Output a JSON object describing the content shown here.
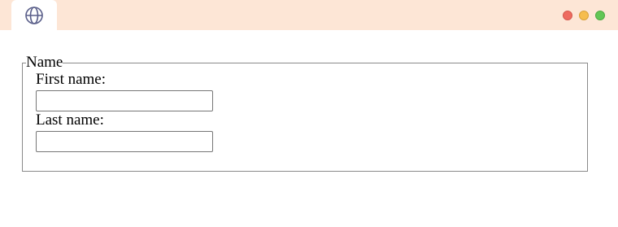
{
  "window": {
    "controls": {
      "close_color": "#ee6a5f",
      "minimize_color": "#f6bd4f",
      "maximize_color": "#62c655"
    },
    "tab_icon": "globe-icon",
    "titlebar_color": "#fde6d6"
  },
  "form": {
    "legend": "Name",
    "first_name": {
      "label": "First name:",
      "value": "",
      "placeholder": ""
    },
    "last_name": {
      "label": "Last name:",
      "value": "",
      "placeholder": ""
    }
  }
}
